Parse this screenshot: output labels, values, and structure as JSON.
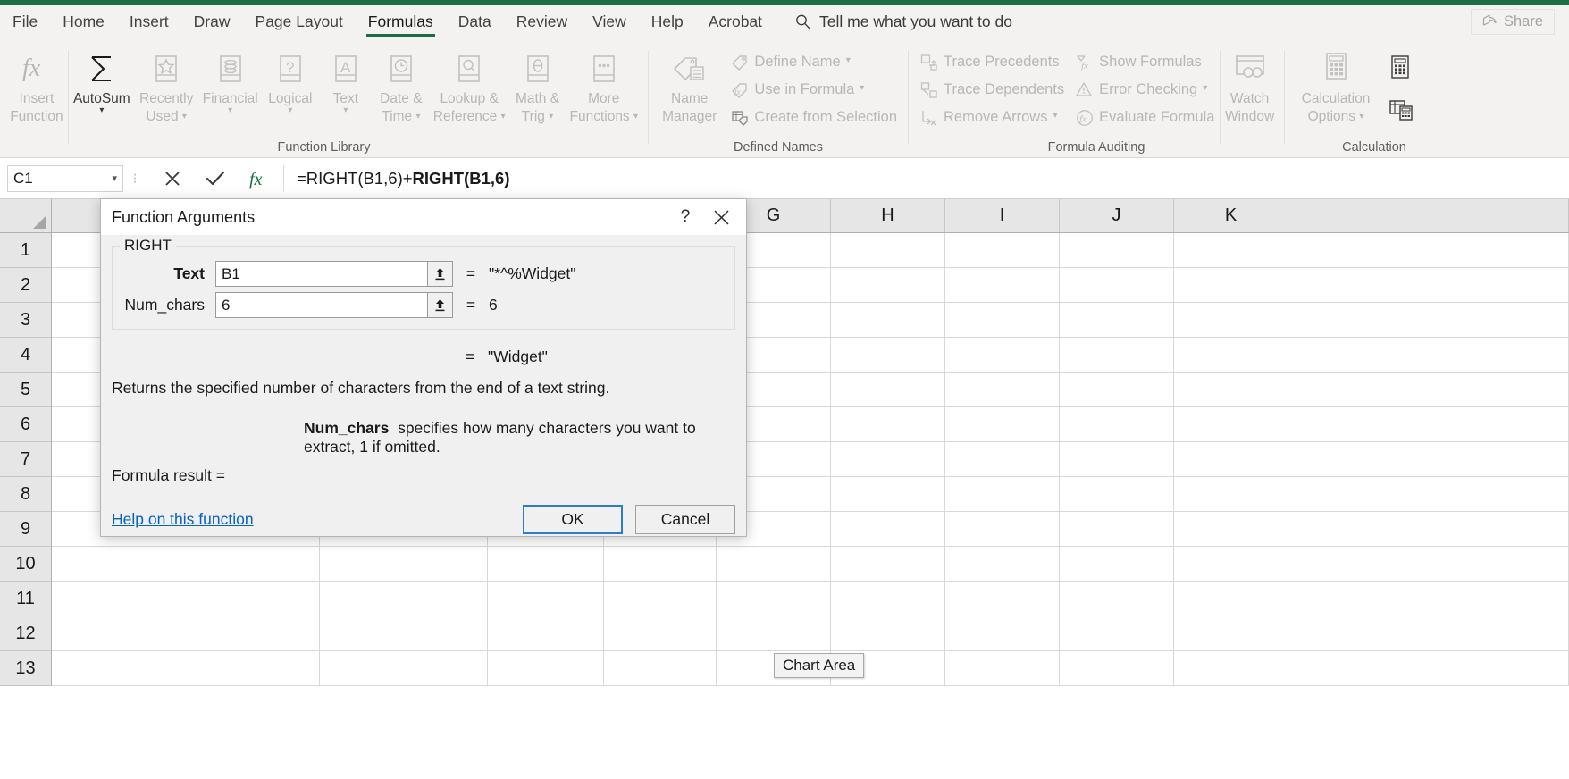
{
  "app": {
    "title": "Excel",
    "accent": "#1e6c41"
  },
  "tabs": [
    {
      "label": "File",
      "active": false
    },
    {
      "label": "Home",
      "active": false
    },
    {
      "label": "Insert",
      "active": false
    },
    {
      "label": "Draw",
      "active": false
    },
    {
      "label": "Page Layout",
      "active": false
    },
    {
      "label": "Formulas",
      "active": true
    },
    {
      "label": "Data",
      "active": false
    },
    {
      "label": "Review",
      "active": false
    },
    {
      "label": "View",
      "active": false
    },
    {
      "label": "Help",
      "active": false
    },
    {
      "label": "Acrobat",
      "active": false
    }
  ],
  "tellme": {
    "label": "Tell me what you want to do",
    "icon": "search-icon"
  },
  "share": {
    "label": "Share",
    "icon": "share-icon"
  },
  "ribbon": {
    "groups": [
      {
        "label": "Function Library",
        "buttons": [
          {
            "label_line1": "Insert",
            "label_line2": "Function",
            "icon": "fx-icon",
            "enabled": false,
            "dropdown": false
          },
          {
            "label_line1": "AutoSum",
            "label_line2": "",
            "icon": "sigma-icon",
            "enabled": true,
            "dropdown": true
          },
          {
            "label_line1": "Recently",
            "label_line2": "Used",
            "icon": "star-book-icon",
            "enabled": false,
            "dropdown": true
          },
          {
            "label_line1": "Financial",
            "label_line2": "",
            "icon": "coins-book-icon",
            "enabled": false,
            "dropdown": true
          },
          {
            "label_line1": "Logical",
            "label_line2": "",
            "icon": "question-book-icon",
            "enabled": false,
            "dropdown": true
          },
          {
            "label_line1": "Text",
            "label_line2": "",
            "icon": "letter-a-book-icon",
            "enabled": false,
            "dropdown": true
          },
          {
            "label_line1": "Date &",
            "label_line2": "Time",
            "icon": "clock-book-icon",
            "enabled": false,
            "dropdown": true
          },
          {
            "label_line1": "Lookup &",
            "label_line2": "Reference",
            "icon": "magnifier-book-icon",
            "enabled": false,
            "dropdown": true
          },
          {
            "label_line1": "Math &",
            "label_line2": "Trig",
            "icon": "theta-book-icon",
            "enabled": false,
            "dropdown": true
          },
          {
            "label_line1": "More",
            "label_line2": "Functions",
            "icon": "ellipsis-book-icon",
            "enabled": false,
            "dropdown": true
          }
        ]
      },
      {
        "label": "Defined Names",
        "big": [
          {
            "label_line1": "Name",
            "label_line2": "Manager",
            "icon": "name-manager-icon",
            "enabled": false,
            "dropdown": false
          }
        ],
        "small": [
          {
            "label": "Define Name",
            "icon": "tag-icon",
            "enabled": false,
            "dropdown": true
          },
          {
            "label": "Use in Formula",
            "icon": "tag-fx-icon",
            "enabled": false,
            "dropdown": true
          },
          {
            "label": "Create from Selection",
            "icon": "grid-tag-icon",
            "enabled": false,
            "dropdown": false
          }
        ]
      },
      {
        "label": "Formula Auditing",
        "smallA": [
          {
            "label": "Trace Precedents",
            "icon": "trace-precedents-icon",
            "enabled": false,
            "dropdown": false
          },
          {
            "label": "Trace Dependents",
            "icon": "trace-dependents-icon",
            "enabled": false,
            "dropdown": false
          },
          {
            "label": "Remove Arrows",
            "icon": "remove-arrows-icon",
            "enabled": false,
            "dropdown": true
          }
        ],
        "smallB": [
          {
            "label": "Show Formulas",
            "icon": "show-formulas-icon",
            "enabled": false,
            "dropdown": false
          },
          {
            "label": "Error Checking",
            "icon": "error-checking-icon",
            "enabled": false,
            "dropdown": true
          },
          {
            "label": "Evaluate Formula",
            "icon": "evaluate-formula-icon",
            "enabled": false,
            "dropdown": false
          }
        ],
        "big": [
          {
            "label_line1": "Watch",
            "label_line2": "Window",
            "icon": "watch-window-icon",
            "enabled": false,
            "dropdown": false
          }
        ]
      },
      {
        "label": "Calculation",
        "big": [
          {
            "label_line1": "Calculation",
            "label_line2": "Options",
            "icon": "calculator-icon",
            "enabled": false,
            "dropdown": true
          }
        ],
        "stack": [
          {
            "icon": "calculate-now-icon",
            "enabled": true
          },
          {
            "icon": "calculate-sheet-icon",
            "enabled": true
          }
        ]
      }
    ]
  },
  "formula_bar": {
    "name_box": "C1",
    "cancel_icon": "cancel-x-icon",
    "enter_icon": "enter-check-icon",
    "insert_function_icon": "fx-icon",
    "formula_plain": "=RIGHT(B1,6)+",
    "formula_bold": "RIGHT(B1,6)"
  },
  "grid": {
    "columns": [
      "G",
      "H",
      "I",
      "J",
      "K"
    ],
    "rows": [
      "1",
      "2",
      "3",
      "4",
      "5",
      "6",
      "7",
      "8",
      "9",
      "10",
      "11",
      "12",
      "13"
    ],
    "chart_tooltip": "Chart Area"
  },
  "dialog": {
    "title": "Function Arguments",
    "help_icon": "question-mark-icon",
    "close_icon": "close-icon",
    "function_name": "RIGHT",
    "args": [
      {
        "label": "Text",
        "bold": true,
        "value": "B1",
        "equals": "=",
        "result": "\"*^%Widget\"",
        "collapse_icon": "collapse-dialog-icon"
      },
      {
        "label": "Num_chars",
        "bold": false,
        "value": "6",
        "equals": "=",
        "result": "6",
        "collapse_icon": "collapse-dialog-icon"
      }
    ],
    "preview_equals": "=",
    "preview_value": "\"Widget\"",
    "description": "Returns the specified number of characters from the end of a text string.",
    "arg_help_name": "Num_chars",
    "arg_help_text": "specifies how many characters you want to extract, 1 if omitted.",
    "formula_result_label": "Formula result =",
    "formula_result_value": "",
    "help_link": "Help on this function",
    "ok_label": "OK",
    "cancel_label": "Cancel"
  }
}
